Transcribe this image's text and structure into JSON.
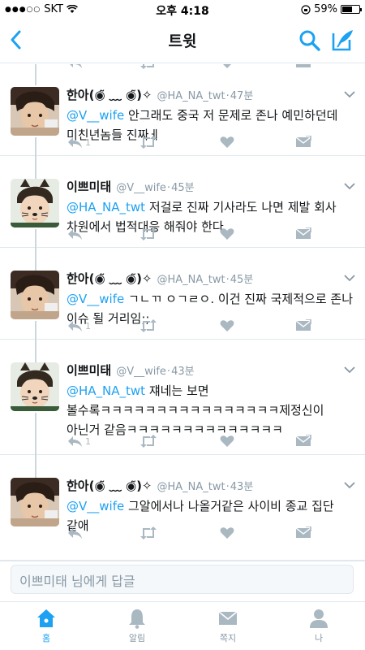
{
  "status_bar": {
    "carrier": "SKT",
    "time": "오후 4:18",
    "battery": "59%",
    "battery_level": 0.59
  },
  "nav": {
    "title": "트윗"
  },
  "tweets": [
    {
      "name": "한아(◉̃ ﹏ ◉̃)✧",
      "handle": "@HA_NA_twt",
      "time": "47분",
      "mention": "@V__wife",
      "text": " 안그래도 중국 저 문제로 존나 예민하던데 미친년놈들 진짜ㅔ",
      "reply_count": "1",
      "avatar": "boy"
    },
    {
      "name": "이쁘미태",
      "handle": "@V__wife",
      "time": "45분",
      "mention": "@HA_NA_twt",
      "text": " 저걸로 진짜 기사라도 나면 제발 회사 차원에서 법적대응 해줘야 한다",
      "reply_count": "",
      "avatar": "cat"
    },
    {
      "name": "한아(◉̃ ﹏ ◉̃)✧",
      "handle": "@HA_NA_twt",
      "time": "45분",
      "mention": "@V__wife",
      "text": " ㄱㄴㄲ ㅇㄱㄹㅇ. 이건 진짜 국제적으로 존나 이슈 될 거리임;;",
      "reply_count": "1",
      "avatar": "boy"
    },
    {
      "name": "이쁘미태",
      "handle": "@V__wife",
      "time": "43분",
      "mention": "@HA_NA_twt",
      "text": " 쟤네는 보면 볼수록ㅋㅋㅋㅋㅋㅋㅋㅋㅋㅋㅋㅋㅋㅋㅋㅋ제정신이 아닌거 같음ㅋㅋㅋㅋㅋㅋㅋㅋㅋㅋㅋㅋㅋㅋ",
      "reply_count": "1",
      "avatar": "cat"
    },
    {
      "name": "한아(◉̃ ﹏ ◉̃)✧",
      "handle": "@HA_NA_twt",
      "time": "43분",
      "mention": "@V__wife",
      "text": " 그알에서나 나올거같은 사이비 종교 집단 같애",
      "reply_count": "",
      "avatar": "boy"
    }
  ],
  "reply_box": {
    "placeholder": "이쁘미태 님에게 답글"
  },
  "tabs": [
    {
      "label": "홈",
      "icon": "home-icon"
    },
    {
      "label": "알림",
      "icon": "bell-icon"
    },
    {
      "label": "쪽지",
      "icon": "envelope-icon"
    },
    {
      "label": "나",
      "icon": "person-icon"
    }
  ],
  "colors": {
    "accent": "#1da1f2",
    "muted": "#aab8c2",
    "text": "#14171a"
  }
}
